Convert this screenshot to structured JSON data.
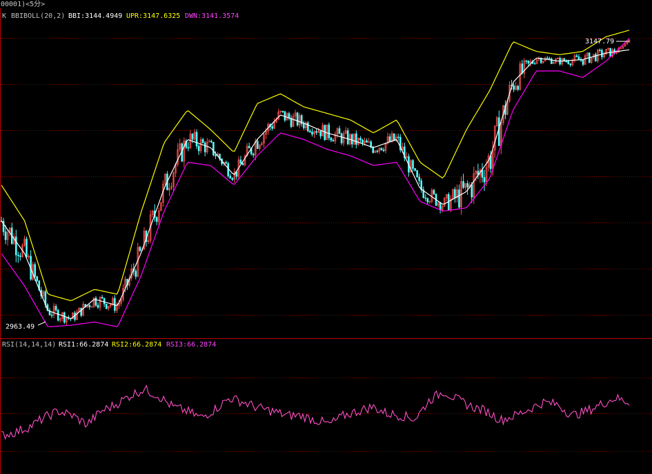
{
  "window": {
    "title": "00001)<5分>"
  },
  "price_panel": {
    "prefix": "K",
    "indicator_name": "BBIBOLL(20,2)",
    "bbi_label": "BBI:3144.4949",
    "upr_label": "UPR:3147.6325",
    "dwn_label": "DWN:3141.3574",
    "max_price_label": "3147.79",
    "min_price_label": "2963.49",
    "colors": {
      "bbi": "#ffffff",
      "upr": "#ffff00",
      "dwn": "#ff00ff",
      "candle_up": "#ff5050",
      "candle_down": "#54ffff",
      "grid": "#8b0000"
    }
  },
  "rsi_panel": {
    "indicator_name": "RSI(14,14,14)",
    "rsi1_label": "RSI1:66.2874",
    "rsi2_label": "RSI2:66.2874",
    "rsi3_label": "RSI3:66.2874",
    "colors": {
      "rsi1": "#ffffff",
      "rsi2": "#ffff00",
      "rsi3": "#ff00ff",
      "line": "#ff50c8"
    }
  },
  "chart_data": [
    {
      "type": "line",
      "panel": "price",
      "indicator": "BBIBOLL(20,2)",
      "y_range": [
        2963.49,
        3147.79
      ],
      "series": [
        {
          "name": "BBI",
          "values": [
            3030,
            3010,
            2975,
            2970,
            2982,
            2978,
            3010,
            3050,
            3080,
            3075,
            3058,
            3080,
            3095,
            3090,
            3084,
            3080,
            3075,
            3080,
            3050,
            3040,
            3048,
            3068,
            3115,
            3130,
            3128,
            3129,
            3133,
            3135
          ]
        },
        {
          "name": "UPR",
          "values": [
            3052,
            3030,
            2985,
            2981,
            2988,
            2985,
            3035,
            3078,
            3098,
            3086,
            3072,
            3102,
            3108,
            3100,
            3096,
            3092,
            3084,
            3092,
            3066,
            3056,
            3086,
            3110,
            3140,
            3134,
            3132,
            3134,
            3143,
            3147
          ]
        },
        {
          "name": "DWN",
          "values": [
            3010,
            2990,
            2965,
            2966,
            2968,
            2965,
            2996,
            3036,
            3066,
            3064,
            3052,
            3070,
            3084,
            3080,
            3074,
            3070,
            3064,
            3066,
            3042,
            3036,
            3038,
            3056,
            3098,
            3122,
            3122,
            3118,
            3128,
            3142
          ]
        }
      ]
    },
    {
      "type": "line",
      "panel": "rsi",
      "indicator": "RSI(14,14,14)",
      "series": [
        {
          "name": "RSI",
          "values": [
            30,
            33,
            38,
            46,
            52,
            48,
            40,
            52,
            58,
            66,
            72,
            66,
            56,
            52,
            46,
            54,
            64,
            60,
            55,
            52,
            48,
            48,
            44,
            40,
            48,
            52,
            56,
            50,
            48,
            45,
            62,
            70,
            62,
            56,
            52,
            44,
            48,
            54,
            60,
            58,
            48,
            52,
            58,
            64,
            60
          ]
        }
      ]
    }
  ]
}
